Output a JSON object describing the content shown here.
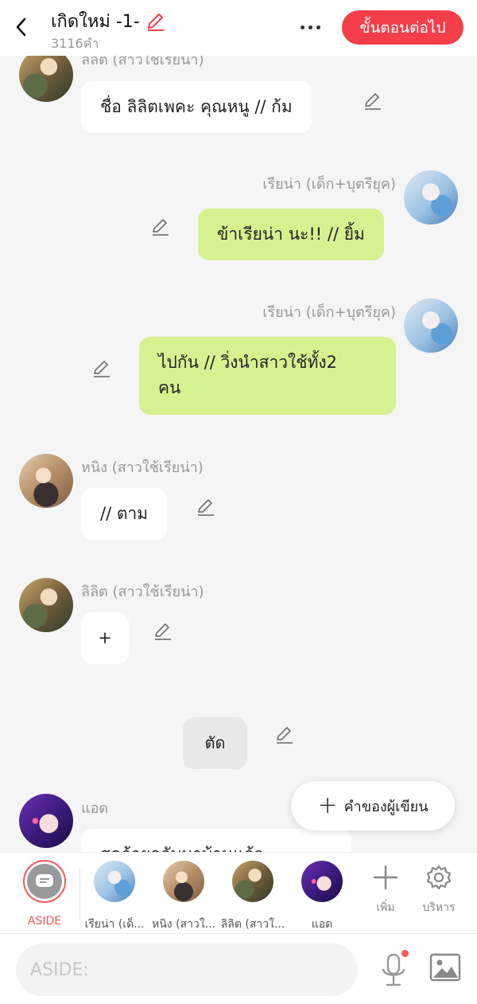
{
  "header": {
    "title": "เกิดใหม่ -1-",
    "word_count": "3116คำ",
    "next_label": "ขั้นตอนต่อไป",
    "accent": "#f43f4a"
  },
  "messages": [
    {
      "speaker": "ลิลิต (สาวใช้เรียน่า)",
      "text": "ชื่อ ลิลิตเพคะ คุณหนู // ก้ม"
    },
    {
      "speaker": "เรียน่า (เด็ก+บุตรียุค)",
      "text": "ข้าเรียน่า นะ!! // ยิ้ม"
    },
    {
      "speaker": "เรียน่า (เด็ก+บุตรียุค)",
      "text_line1": "ไปกัน  // วิ่งนำสาวใช้ทั้ง2",
      "text_line2": "คน"
    },
    {
      "speaker": "หนิง (สาวใช้เรียน่า)",
      "text": "// ตาม"
    },
    {
      "speaker": "ลิลิต (สาวใช้เรียน่า)",
      "text": "+"
    },
    {
      "text": "ตัด"
    },
    {
      "speaker": "แอด",
      "text": "สุดฤ้ายกลับมาบ้านแล้ว"
    }
  ],
  "fab": {
    "label": "คำของผู้เขียน"
  },
  "characters": [
    {
      "label": "ASIDE"
    },
    {
      "label": "เรียน่า (เด็..."
    },
    {
      "label": "หนิง (สาวใ..."
    },
    {
      "label": "ลิลิต (สาวใ..."
    },
    {
      "label": "แอด"
    }
  ],
  "tools": {
    "add_label": "เพิ่ม",
    "manage_label": "บริหาร"
  },
  "input": {
    "placeholder": "ASIDE:"
  },
  "colors": {
    "green_bubble": "#d6f290",
    "aside_red": "#f25a5a"
  }
}
